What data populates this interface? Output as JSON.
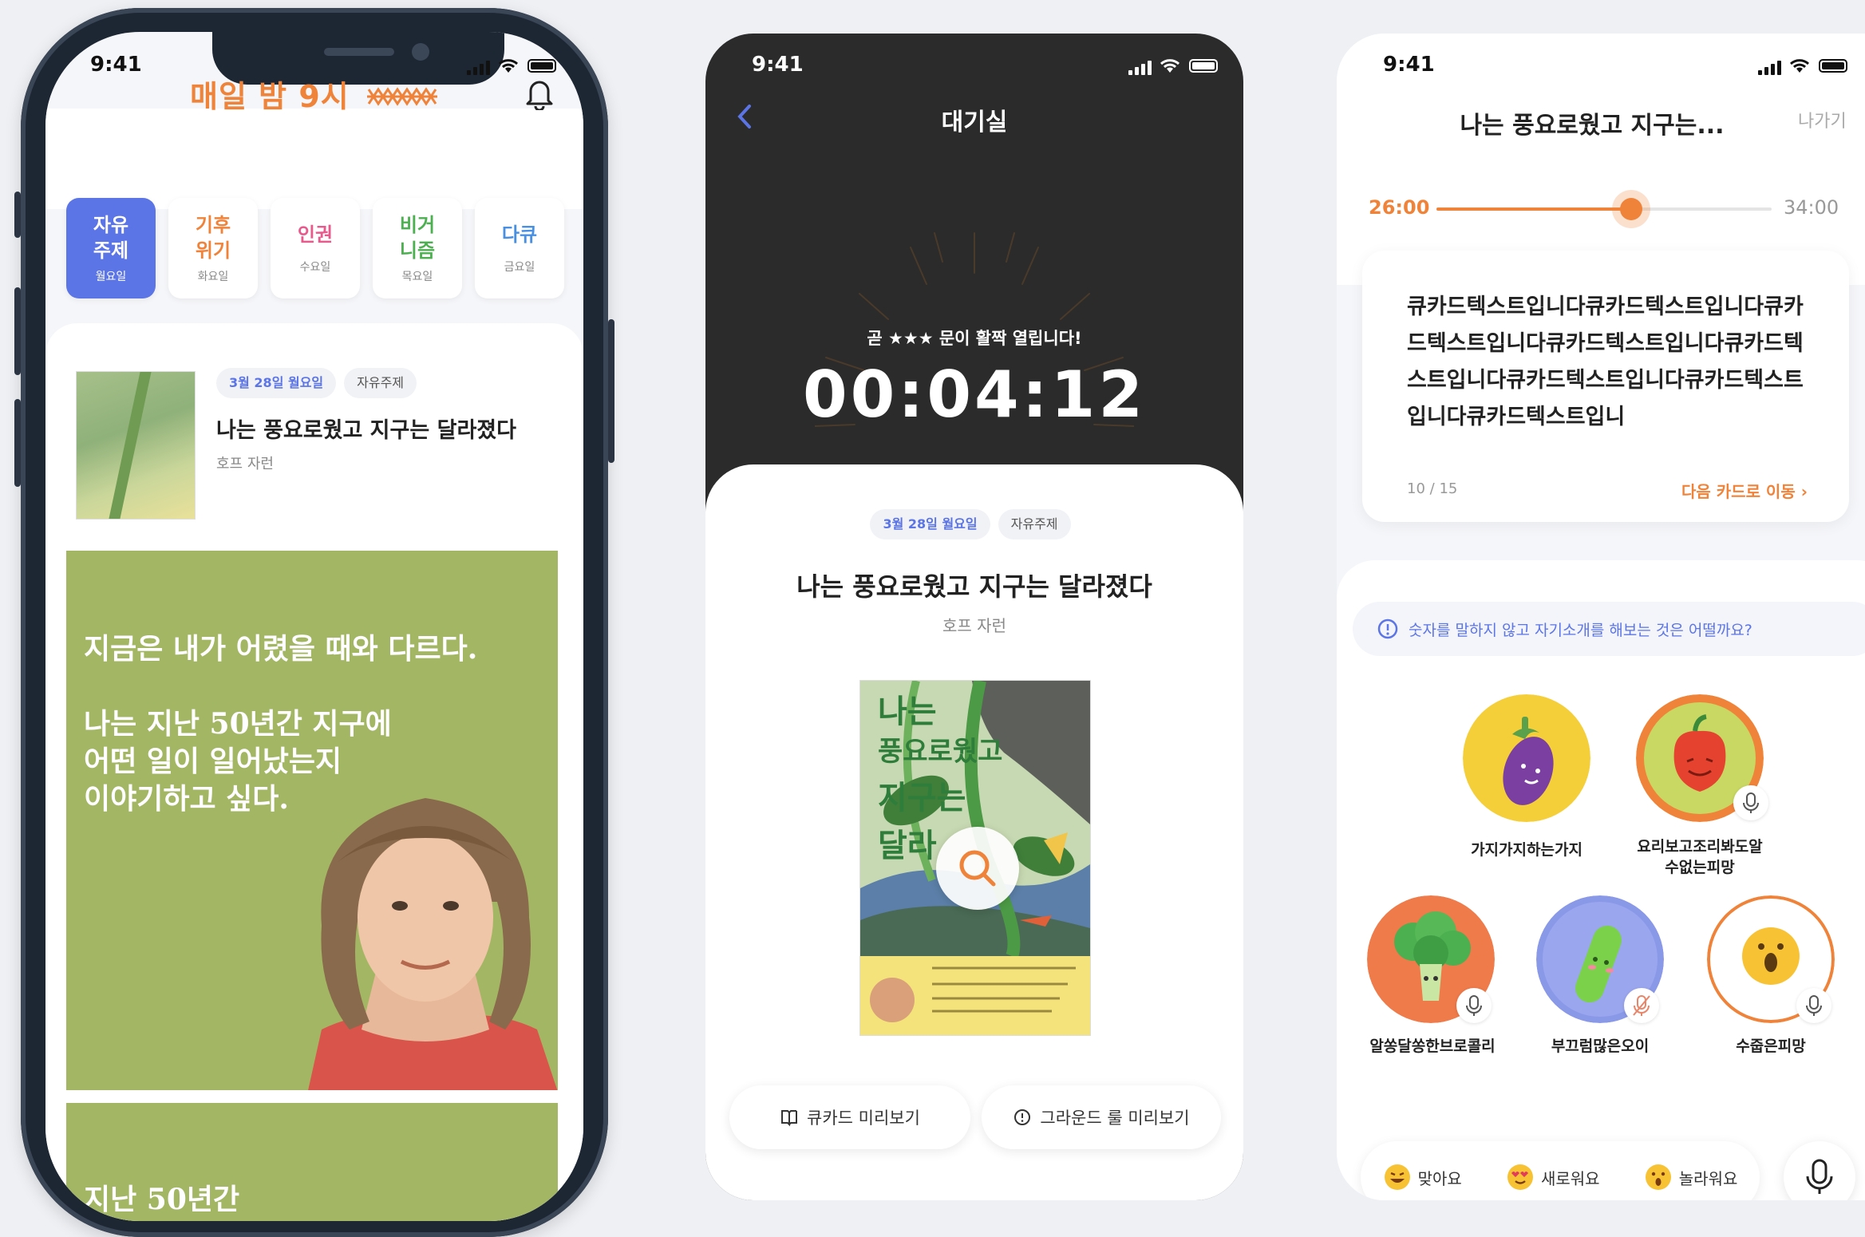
{
  "status_time": "9:41",
  "screen1": {
    "logo": "매일 밤 9시",
    "day_tabs": [
      {
        "title": "자유\n주제",
        "day": "월요일",
        "color": "#ffffff",
        "active": true
      },
      {
        "title": "기후\n위기",
        "day": "화요일",
        "color": "#f0833a",
        "active": false
      },
      {
        "title": "인권",
        "day": "수요일",
        "color": "#e65b8c",
        "active": false
      },
      {
        "title": "비거\n니즘",
        "day": "목요일",
        "color": "#4caf50",
        "active": false
      },
      {
        "title": "다큐",
        "day": "금요일",
        "color": "#4a90e2",
        "active": false
      }
    ],
    "book": {
      "date": "3월 28일 월요일",
      "category": "자유주제",
      "title": "나는 풍요로웠고 지구는 달라졌다",
      "author": "호프 자런"
    },
    "quote": "지금은 내가 어렸을 때와 다르다.\n\n나는 지난 50년간 지구에\n어떤 일이 일어났는지\n이야기하고 싶다.",
    "quote2": "지난 50년간"
  },
  "screen2": {
    "title": "대기실",
    "subtitle": "곧 ★★★ 문이 활짝 열립니다!",
    "timer": "00:04:12",
    "date": "3월 28일 월요일",
    "category": "자유주제",
    "book_title": "나는 풍요로웠고 지구는 달라졌다",
    "author": "호프 자런",
    "btn_card_preview": "큐카드 미리보기",
    "btn_ground_rule": "그라운드 룰 미리보기"
  },
  "screen3": {
    "title": "나는 풍요로웠고 지구는...",
    "exit": "나가기",
    "time_elapsed": "26:00",
    "time_total": "34:00",
    "progress": 0.58,
    "card_text": "큐카드텍스트입니다큐카드텍스트입니다큐카드텍스트입니다큐카드텍스트입니다큐카드텍스트입니다큐카드텍스트입니다큐카드텍스트입니다큐카드텍스트입니",
    "card_index": "10",
    "card_total": "15",
    "card_slash": "/",
    "next_card": "다음 카드로 이동",
    "hint": "숫자를 말하지 않고 자기소개를 해보는 것은 어떨까요?",
    "participants": [
      {
        "name": "가지가지하는가지",
        "bg": "#f5cf3a",
        "icon": "eggplant-icon"
      },
      {
        "name": "요리보고조리봐도알\n수없는피망",
        "bg": "#f0833a",
        "icon": "pepper-icon"
      },
      {
        "name": "알쏭달쏭한브로콜리",
        "bg": "#ef7a4a",
        "icon": "broccoli-icon"
      },
      {
        "name": "부끄럼많은오이",
        "bg": "#8a98e8",
        "icon": "cucumber-icon"
      },
      {
        "name": "수줍은피망",
        "bg": "#ffffff",
        "icon": "face-icon"
      }
    ],
    "reactions": [
      {
        "label": "맞아요",
        "icon": "grin-emoji-icon"
      },
      {
        "label": "새로워요",
        "icon": "heart-eyes-emoji-icon"
      },
      {
        "label": "놀라워요",
        "icon": "surprised-emoji-icon"
      }
    ]
  }
}
